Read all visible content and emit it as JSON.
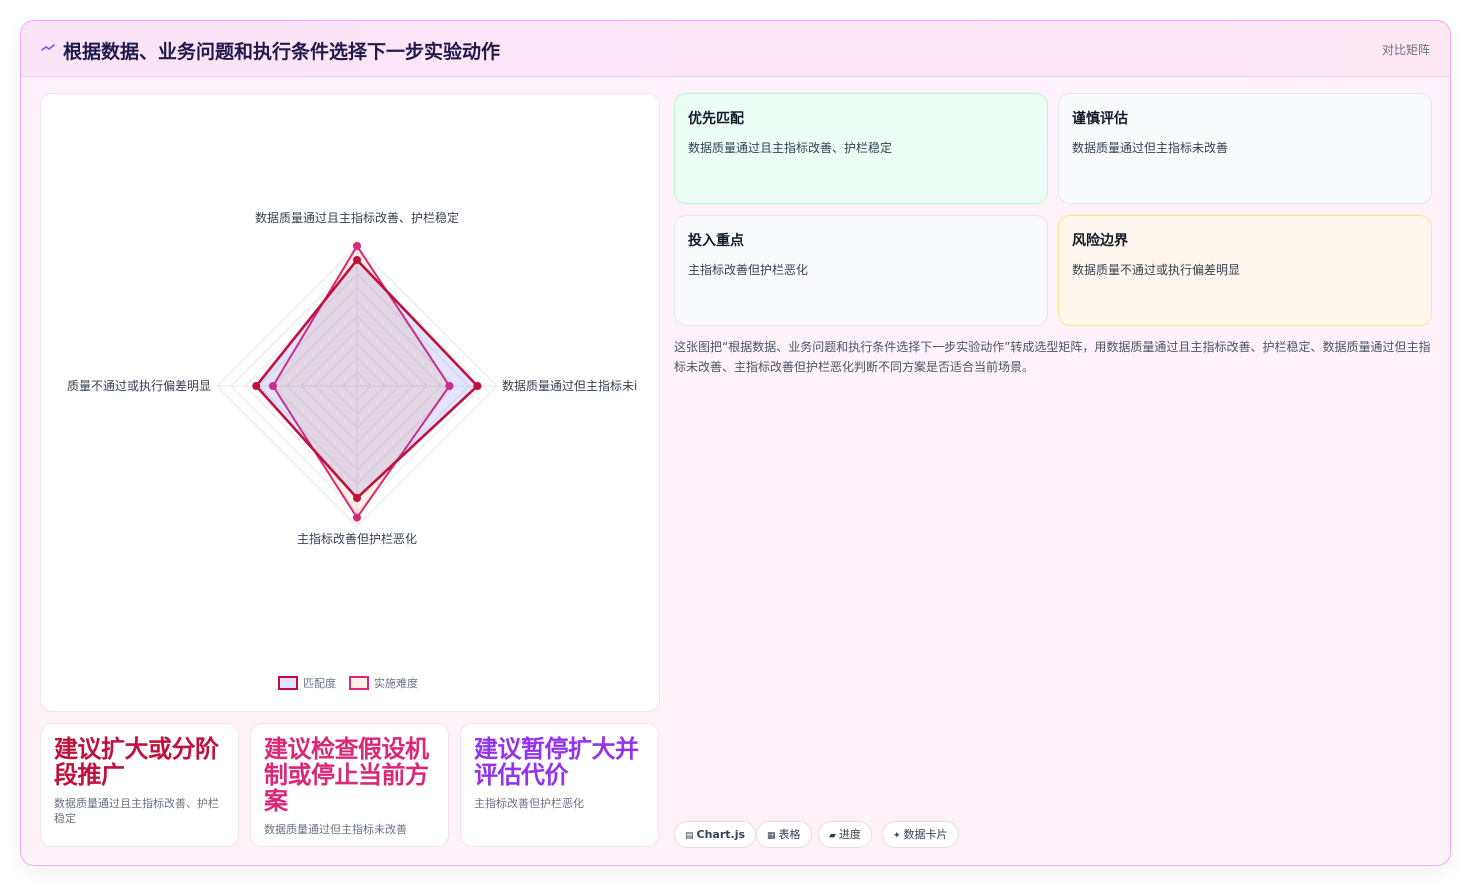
{
  "header": {
    "title": "根据数据、业务问题和执行条件选择下一步实验动作",
    "link_label": "对比矩阵"
  },
  "chart_data": {
    "type": "radar",
    "axes": [
      "数据质量通过且主指标改善、护栏稳定",
      "数据质量通过但主指标未改善",
      "主指标改善但护栏恶化",
      "数据质量不通过或执行偏差明显"
    ],
    "axis_labels_display": [
      "数据质量通过且主指标改善、护栏稳定",
      "数据质量通过但主指标未i",
      "主指标改善但护栏恶化",
      "质量不通过或执行偏差明显"
    ],
    "rlim": [
      0,
      100
    ],
    "series": [
      {
        "name": "匹配度",
        "values": [
          90,
          86,
          80,
          72
        ],
        "color": "#be123c",
        "fill": "rgba(99,102,241,0.18)"
      },
      {
        "name": "实施难度",
        "values": [
          100,
          66,
          94,
          60
        ],
        "color": "#db2777",
        "fill": "rgba(251,146,60,0.14)"
      }
    ],
    "legend": "bottom"
  },
  "bottom_cards": [
    {
      "title": "建议扩大或分阶段推广",
      "desc": "数据质量通过且主指标改善、护栏稳定",
      "color": "#be123c"
    },
    {
      "title": "建议检查假设机制或停止当前方案",
      "desc": "数据质量通过但主指标未改善",
      "color": "#db2777"
    },
    {
      "title": "建议暂停扩大并评估代价",
      "desc": "主指标改善但护栏恶化",
      "color": "#9333ea"
    }
  ],
  "options": [
    {
      "title": "优先匹配",
      "desc": "数据质量通过且主指标改善、护栏稳定",
      "bg": "#ecfdf5",
      "border": "#bbf7d0"
    },
    {
      "title": "谨慎评估",
      "desc": "数据质量通过但主指标未改善",
      "bg": "#f8fafc",
      "border": "#e5e7eb"
    },
    {
      "title": "投入重点",
      "desc": "主指标改善但护栏恶化",
      "bg": "#f8fafc",
      "border": "#e5e7eb"
    },
    {
      "title": "风险边界",
      "desc": "数据质量不通过或执行偏差明显",
      "bg": "#fff7ed",
      "border": "#fde68a"
    }
  ],
  "description": "这张图把“根据数据、业务问题和执行条件选择下一步实验动作”转成选型矩阵，用数据质量通过且主指标改善、护栏稳定、数据质量通过但主指标未改善、主指标改善但护栏恶化判断不同方案是否适合当前场景。",
  "chips": [
    {
      "icon": "▤",
      "label": "Chart.js"
    },
    {
      "icon": "▦",
      "label": "表格"
    },
    {
      "icon": "▰",
      "label": "进度"
    },
    {
      "icon": "✦",
      "label": "数据卡片"
    }
  ]
}
